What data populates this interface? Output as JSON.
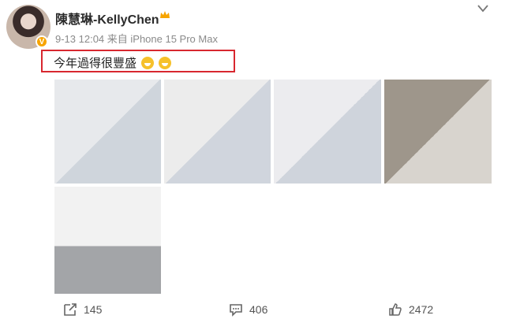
{
  "user": {
    "name": "陳慧琳-KellyChen",
    "badge_icon": "verified-badge-icon",
    "crown_icon": "crown-icon"
  },
  "post": {
    "meta": "9-13 12:04 来自 iPhone 15 Pro Max",
    "text": "今年過得很豐盛",
    "emoji_icons": [
      "grinning-face-icon",
      "grinning-face-icon"
    ],
    "photo_count": 5,
    "photos": [
      "photo-1",
      "photo-2",
      "photo-3",
      "photo-4",
      "photo-5"
    ]
  },
  "footer": {
    "share_count": "145",
    "comment_count": "406",
    "like_count": "2472",
    "share_icon": "share-icon",
    "comment_icon": "comment-icon",
    "like_icon": "thumbs-up-icon"
  },
  "colors": {
    "highlight": "#d8272f",
    "verified": "#f7a400",
    "meta_text": "#8a8a8a"
  }
}
